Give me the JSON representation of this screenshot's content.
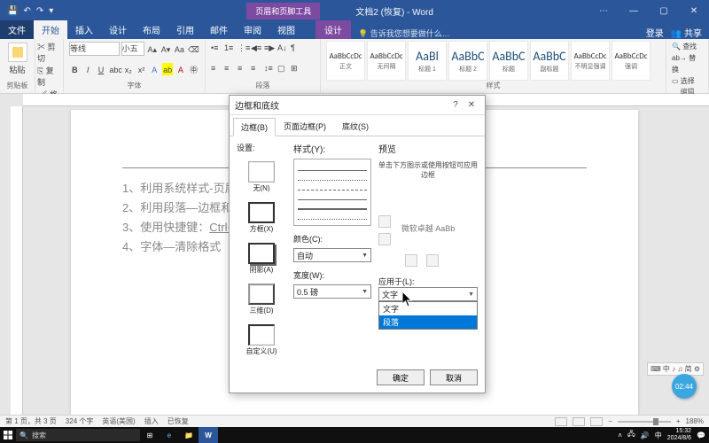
{
  "titlebar": {
    "context_group": "页眉和页脚工具",
    "doc_title": "文档2 (恢复) - Word"
  },
  "ribbon_tabs": {
    "file": "文件",
    "home": "开始",
    "insert": "插入",
    "design": "设计",
    "layout": "布局",
    "references": "引用",
    "mailings": "邮件",
    "review": "审阅",
    "view": "视图",
    "context_design": "设计",
    "tell_me": "告诉我您想要做什么…",
    "signin": "登录",
    "share": "共享"
  },
  "ribbon": {
    "clipboard": {
      "paste": "粘贴",
      "cut": "剪切",
      "copy": "复制",
      "painter": "格式刷",
      "label": "剪贴板"
    },
    "font": {
      "name": "等线",
      "size": "小五",
      "label": "字体"
    },
    "para": {
      "label": "段落"
    },
    "styles": {
      "items": [
        {
          "preview": "AaBbCcDc",
          "name": "正文"
        },
        {
          "preview": "AaBbCcDc",
          "name": "无间隔"
        },
        {
          "preview": "AaBl",
          "name": "标题 1"
        },
        {
          "preview": "AaBbC",
          "name": "标题 2"
        },
        {
          "preview": "AaBbC",
          "name": "标题"
        },
        {
          "preview": "AaBbC",
          "name": "副标题"
        },
        {
          "preview": "AaBbCcDc",
          "name": "不明显强调"
        },
        {
          "preview": "AaBbCcDc",
          "name": "强调"
        }
      ],
      "label": "样式"
    },
    "editing": {
      "find": "查找",
      "replace": "替换",
      "select": "选择",
      "label": "编辑"
    }
  },
  "document": {
    "lines": [
      {
        "n": "1、",
        "text": "利用系统样式-页眉",
        "tail": "。"
      },
      {
        "n": "2、",
        "text": "利用段落—边框和底纹",
        "tail": "。"
      },
      {
        "n": "3、",
        "text_pre": "使用快捷键：",
        "u": "Ctrl+Shift+N",
        "tail": "。"
      },
      {
        "n": "4、",
        "text": "字体—清除格式（很彻底）",
        "tail": ""
      }
    ]
  },
  "dialog": {
    "title": "边框和底纹",
    "tabs": {
      "border": "边框(B)",
      "page_border": "页面边框(P)",
      "shading": "底纹(S)"
    },
    "settings_label": "设置:",
    "settings": {
      "none": "无(N)",
      "box": "方框(X)",
      "shadow": "阴影(A)",
      "threed": "三维(D)",
      "custom": "自定义(U)"
    },
    "style_label": "样式(Y):",
    "color_label": "颜色(C):",
    "color_value": "自动",
    "width_label": "宽度(W):",
    "width_value": "0.5 磅",
    "preview_label": "预览",
    "preview_hint": "单击下方图示或使用按钮可应用边框",
    "preview_sample": "微软卓越 AaBb",
    "apply_label": "应用于(L):",
    "apply_value": "文字",
    "apply_options": [
      "文字",
      "段落"
    ],
    "ok": "确定",
    "cancel": "取消"
  },
  "statusbar": {
    "page": "第 1 页，共 3 页",
    "words": "324 个字",
    "lang": "英语(美国)",
    "insert": "插入",
    "recovered": "已恢复",
    "zoom": "188%"
  },
  "taskbar": {
    "search_placeholder": "搜索",
    "ime": "中",
    "time": "15:32",
    "date": "2024/8/6"
  },
  "timer": "02:44",
  "ime_bar": "⌨ 中 ♪ ♫ 简 ⚙"
}
